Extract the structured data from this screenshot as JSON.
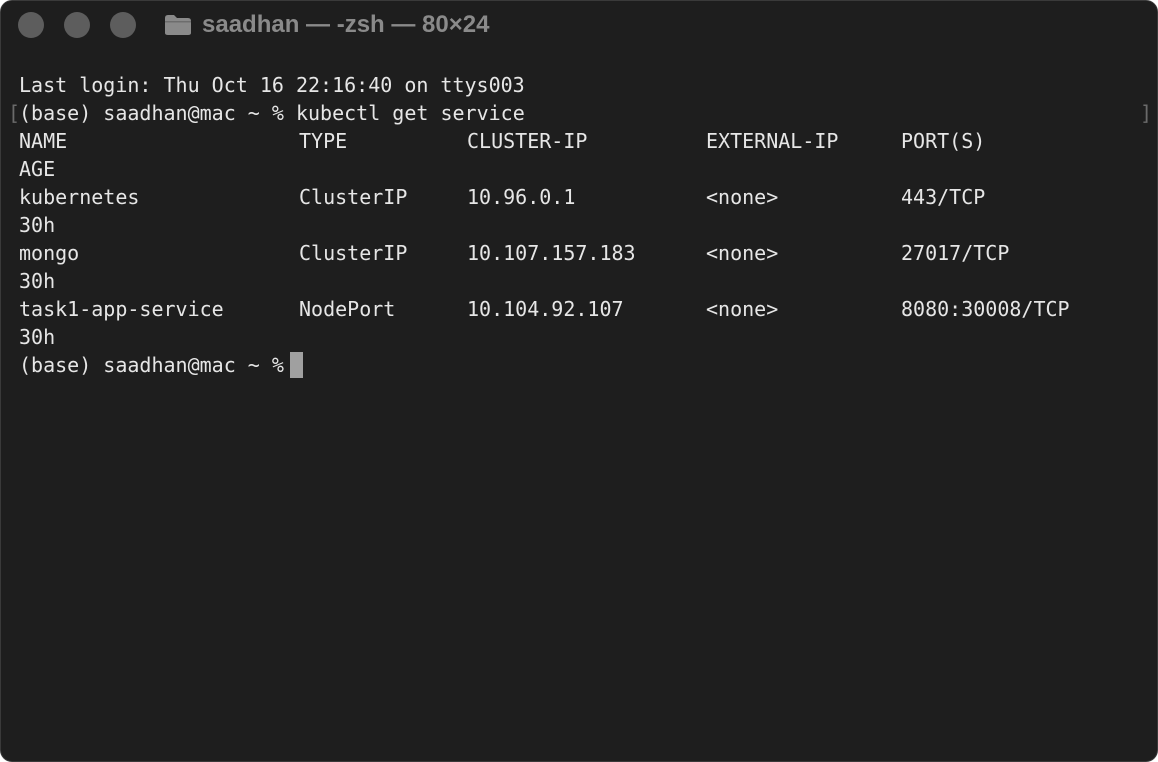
{
  "window": {
    "title": "saadhan — -zsh — 80×24"
  },
  "terminal": {
    "last_login": "Last login: Thu Oct 16 22:16:40 on ttys003",
    "prompt": "(base) saadhan@mac ~ %",
    "command": "kubectl get service",
    "headers": [
      "NAME",
      "TYPE",
      "CLUSTER-IP",
      "EXTERNAL-IP",
      "PORT(S)",
      "AGE"
    ],
    "rows": [
      [
        "kubernetes",
        "ClusterIP",
        "10.96.0.1",
        "<none>",
        "443/TCP",
        "30h"
      ],
      [
        "mongo",
        "ClusterIP",
        "10.107.157.183",
        "<none>",
        "27017/TCP",
        "30h"
      ],
      [
        "task1-app-service",
        "NodePort",
        "10.104.92.107",
        "<none>",
        "8080:30008/TCP",
        "30h"
      ]
    ],
    "final_prompt": "(base) saadhan@mac ~ %"
  },
  "colors": {
    "background": "#1e1e1e",
    "text": "#e6e6e6",
    "title": "#8a8a8a",
    "traffic_light": "#5d5d5d",
    "cursor": "#a0a0a0"
  },
  "icons": {
    "title_icon": "folder-icon"
  }
}
